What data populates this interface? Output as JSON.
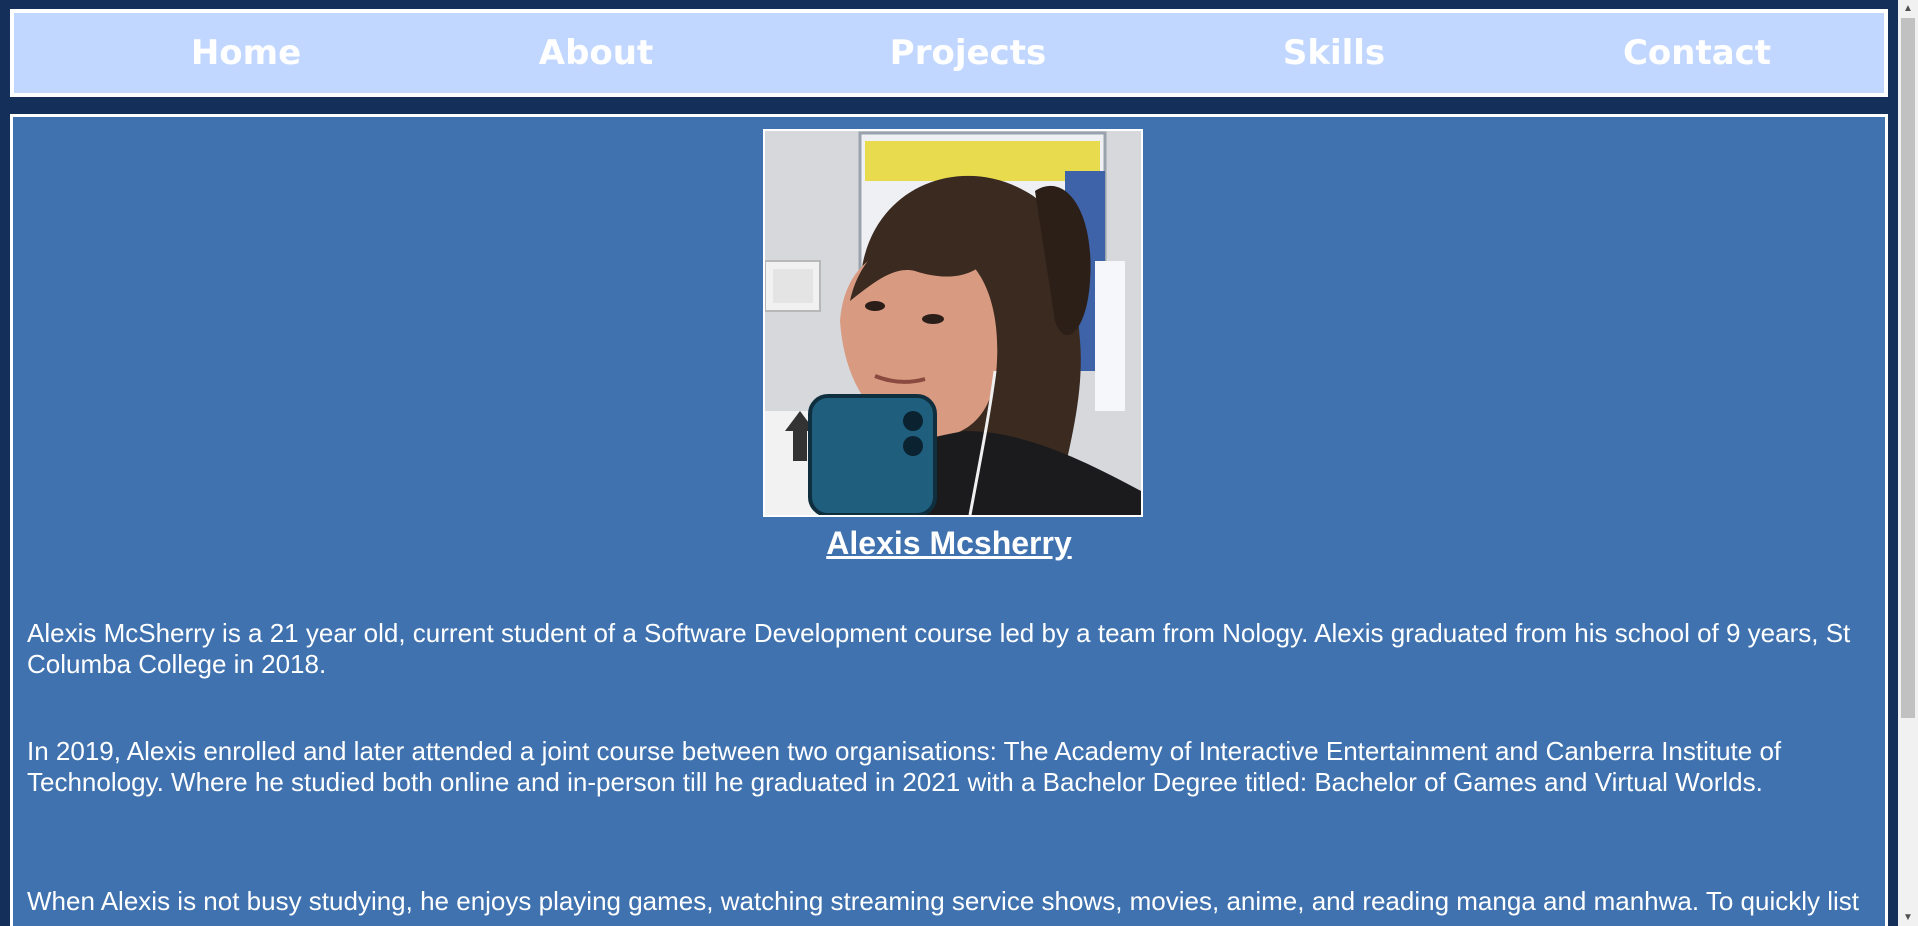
{
  "nav": {
    "items": [
      {
        "label": "Home"
      },
      {
        "label": "About"
      },
      {
        "label": "Projects"
      },
      {
        "label": "Skills"
      },
      {
        "label": "Contact"
      }
    ]
  },
  "profile": {
    "name": "Alexis Mcsherry",
    "photo_icon": "profile-photo"
  },
  "about": {
    "paragraphs": [
      "Alexis McSherry is a 21 year old, current student of a Software Development course led by a team from Nology. Alexis graduated from his school of 9 years, St Columba College in 2018.",
      "In 2019, Alexis enrolled and later attended a joint course between two organisations: The Academy of Interactive Entertainment and Canberra Institute of Technology. Where he studied both online and in-person till he graduated in 2021 with a Bachelor Degree titled: Bachelor of Games and Virtual Worlds.",
      "When Alexis is not busy studying, he enjoys playing games, watching streaming service shows, movies, anime, and reading manga and manhwa. To quickly list"
    ]
  },
  "scrollbar": {
    "up_icon": "scroll-up-arrow-icon",
    "down_icon": "scroll-down-arrow-icon"
  },
  "colors": {
    "page_bg": "#14305a",
    "nav_bg": "#c2d7ff",
    "content_bg": "#3f72af",
    "text": "#ffffff"
  }
}
